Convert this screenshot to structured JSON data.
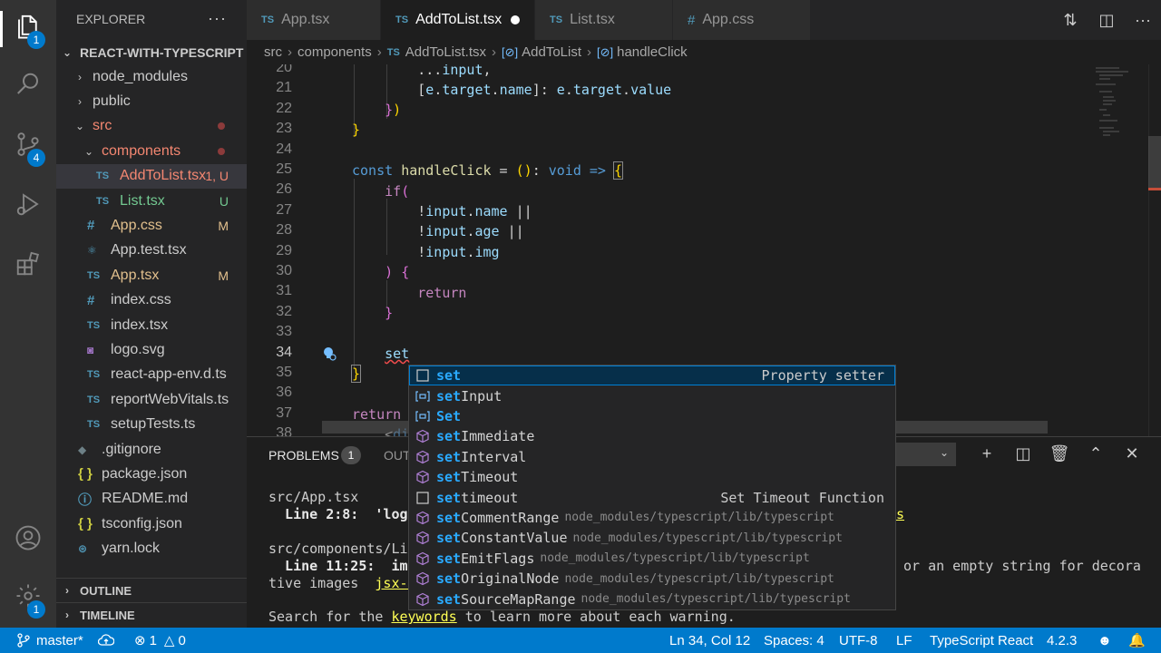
{
  "activity": {
    "explorer_badge": "1",
    "scm_badge": "4",
    "settings_badge": "1"
  },
  "sidebar": {
    "title": "EXPLORER",
    "project": "REACT-WITH-TYPESCRIPT",
    "tree": [
      {
        "label": "node_modules",
        "kind": "folder",
        "open": false,
        "depth": 1
      },
      {
        "label": "public",
        "kind": "folder",
        "open": false,
        "depth": 1
      },
      {
        "label": "src",
        "kind": "folder",
        "open": true,
        "depth": 1,
        "dot": true
      },
      {
        "label": "components",
        "kind": "folder",
        "open": true,
        "depth": 2,
        "dot": true
      },
      {
        "label": "AddToList.tsx",
        "kind": "ts",
        "depth": 3,
        "badge": "1, U",
        "selected": true
      },
      {
        "label": "List.tsx",
        "kind": "ts",
        "depth": 3,
        "badge": "U"
      },
      {
        "label": "App.css",
        "kind": "css",
        "depth": 2,
        "badge": "M"
      },
      {
        "label": "App.test.tsx",
        "kind": "react",
        "depth": 2
      },
      {
        "label": "App.tsx",
        "kind": "ts",
        "depth": 2,
        "badge": "M"
      },
      {
        "label": "index.css",
        "kind": "css",
        "depth": 2
      },
      {
        "label": "index.tsx",
        "kind": "ts",
        "depth": 2
      },
      {
        "label": "logo.svg",
        "kind": "svg",
        "depth": 2
      },
      {
        "label": "react-app-env.d.ts",
        "kind": "ts",
        "depth": 2
      },
      {
        "label": "reportWebVitals.ts",
        "kind": "ts",
        "depth": 2
      },
      {
        "label": "setupTests.ts",
        "kind": "ts",
        "depth": 2
      },
      {
        "label": ".gitignore",
        "kind": "git",
        "depth": 1
      },
      {
        "label": "package.json",
        "kind": "json",
        "depth": 1
      },
      {
        "label": "README.md",
        "kind": "md",
        "depth": 1
      },
      {
        "label": "tsconfig.json",
        "kind": "json",
        "depth": 1
      },
      {
        "label": "yarn.lock",
        "kind": "yarn",
        "depth": 1
      }
    ],
    "outline": "OUTLINE",
    "timeline": "TIMELINE"
  },
  "tabs": [
    {
      "label": "App.tsx",
      "icon": "TS"
    },
    {
      "label": "AddToList.tsx",
      "icon": "TS",
      "active": true,
      "dirty": true
    },
    {
      "label": "List.tsx",
      "icon": "TS"
    },
    {
      "label": "App.css",
      "icon": "#"
    }
  ],
  "breadcrumb": [
    "src",
    "components",
    "AddToList.tsx",
    "AddToList",
    "handleClick"
  ],
  "editor": {
    "line_numbers": [
      "20",
      "21",
      "22",
      "23",
      "24",
      "25",
      "26",
      "27",
      "28",
      "29",
      "30",
      "31",
      "32",
      "33",
      "34",
      "35",
      "36",
      "37",
      "38"
    ],
    "current_line": "34"
  },
  "panel": {
    "problems_label": "PROBLEMS",
    "problems_count": "1",
    "output_label": "OUT",
    "lines": {
      "l1": "src/App.tsx",
      "l2a": "  Line 2:8:  'logo",
      "l2b": "s",
      "l3": "src/components/Lis",
      "l4a": "  Line 11:25:  img",
      "l4b": "or an empty string for decora",
      "l5a": "tive images  ",
      "l5b": "jsx-a",
      "l6a": "Search for the ",
      "l6b": "keywords",
      "l6c": " to learn more about each warning."
    }
  },
  "suggest": [
    {
      "hl": "set",
      "rest": "",
      "icon": "square",
      "rdetail": "Property setter"
    },
    {
      "hl": "set",
      "rest": "Input",
      "icon": "var"
    },
    {
      "hl": "Set",
      "rest": "",
      "icon": "var"
    },
    {
      "hl": "set",
      "rest": "Immediate",
      "icon": "cube"
    },
    {
      "hl": "set",
      "rest": "Interval",
      "icon": "cube"
    },
    {
      "hl": "set",
      "rest": "Timeout",
      "icon": "cube"
    },
    {
      "hl": "set",
      "rest": "timeout",
      "icon": "square",
      "rdetail": "Set Timeout Function"
    },
    {
      "hl": "set",
      "rest": "CommentRange",
      "icon": "cube",
      "detail": "node_modules/typescript/lib/typescript"
    },
    {
      "hl": "set",
      "rest": "ConstantValue",
      "icon": "cube",
      "detail": "node_modules/typescript/lib/typescript"
    },
    {
      "hl": "set",
      "rest": "EmitFlags",
      "icon": "cube",
      "detail": "node_modules/typescript/lib/typescript"
    },
    {
      "hl": "set",
      "rest": "OriginalNode",
      "icon": "cube",
      "detail": "node_modules/typescript/lib/typescript"
    },
    {
      "hl": "set",
      "rest": "SourceMapRange",
      "icon": "cube",
      "detail": "node_modules/typescript/lib/typescript"
    }
  ],
  "status": {
    "branch": "master*",
    "errors": "1",
    "warnings": "0",
    "position": "Ln 34, Col 12",
    "spaces": "Spaces: 4",
    "encoding": "UTF-8",
    "eol": "LF",
    "language": "TypeScript React",
    "version": "4.2.3"
  }
}
